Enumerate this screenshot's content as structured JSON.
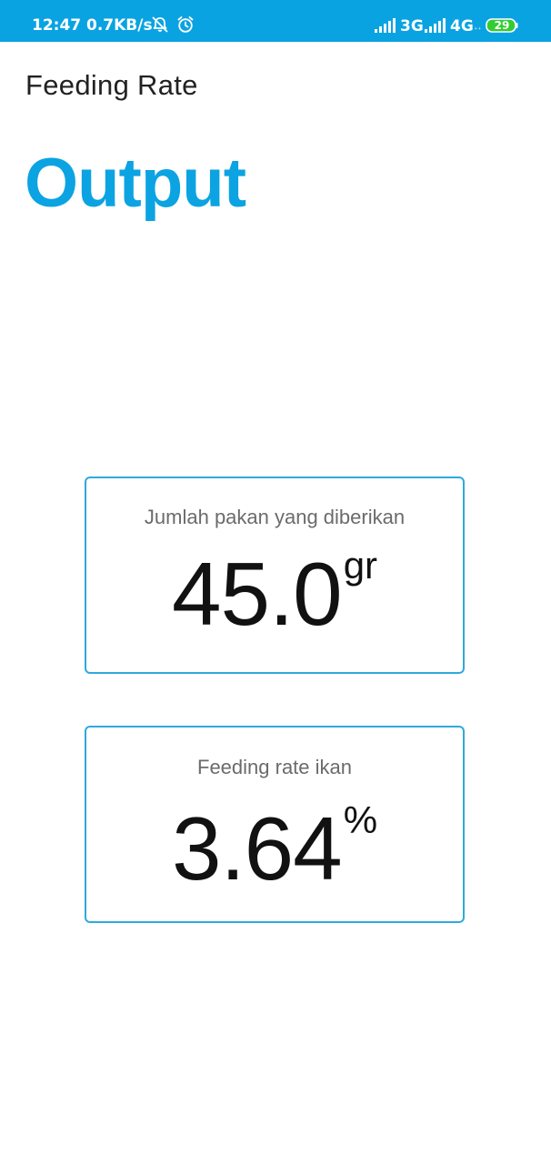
{
  "status_bar": {
    "time": "12:47",
    "net_speed": "0.7KB/s",
    "network_1": "3G",
    "network_2": "4G",
    "network_2_sub": "⁺⁺",
    "battery": "29",
    "icons": [
      "mute-notification-icon",
      "alarm-icon",
      "signal-icon",
      "signal-icon",
      "battery-icon"
    ],
    "color": "#0aa3e2"
  },
  "toolbar": {
    "title": "Feeding Rate"
  },
  "heading": {
    "text": "Output",
    "color": "#0ca3e2"
  },
  "cards": [
    {
      "label": "Jumlah pakan yang diberikan",
      "value": "45.0",
      "unit": "gr"
    },
    {
      "label": "Feeding rate ikan",
      "value": "3.64",
      "unit": "%"
    }
  ],
  "card_border_color": "#2fa9dd"
}
